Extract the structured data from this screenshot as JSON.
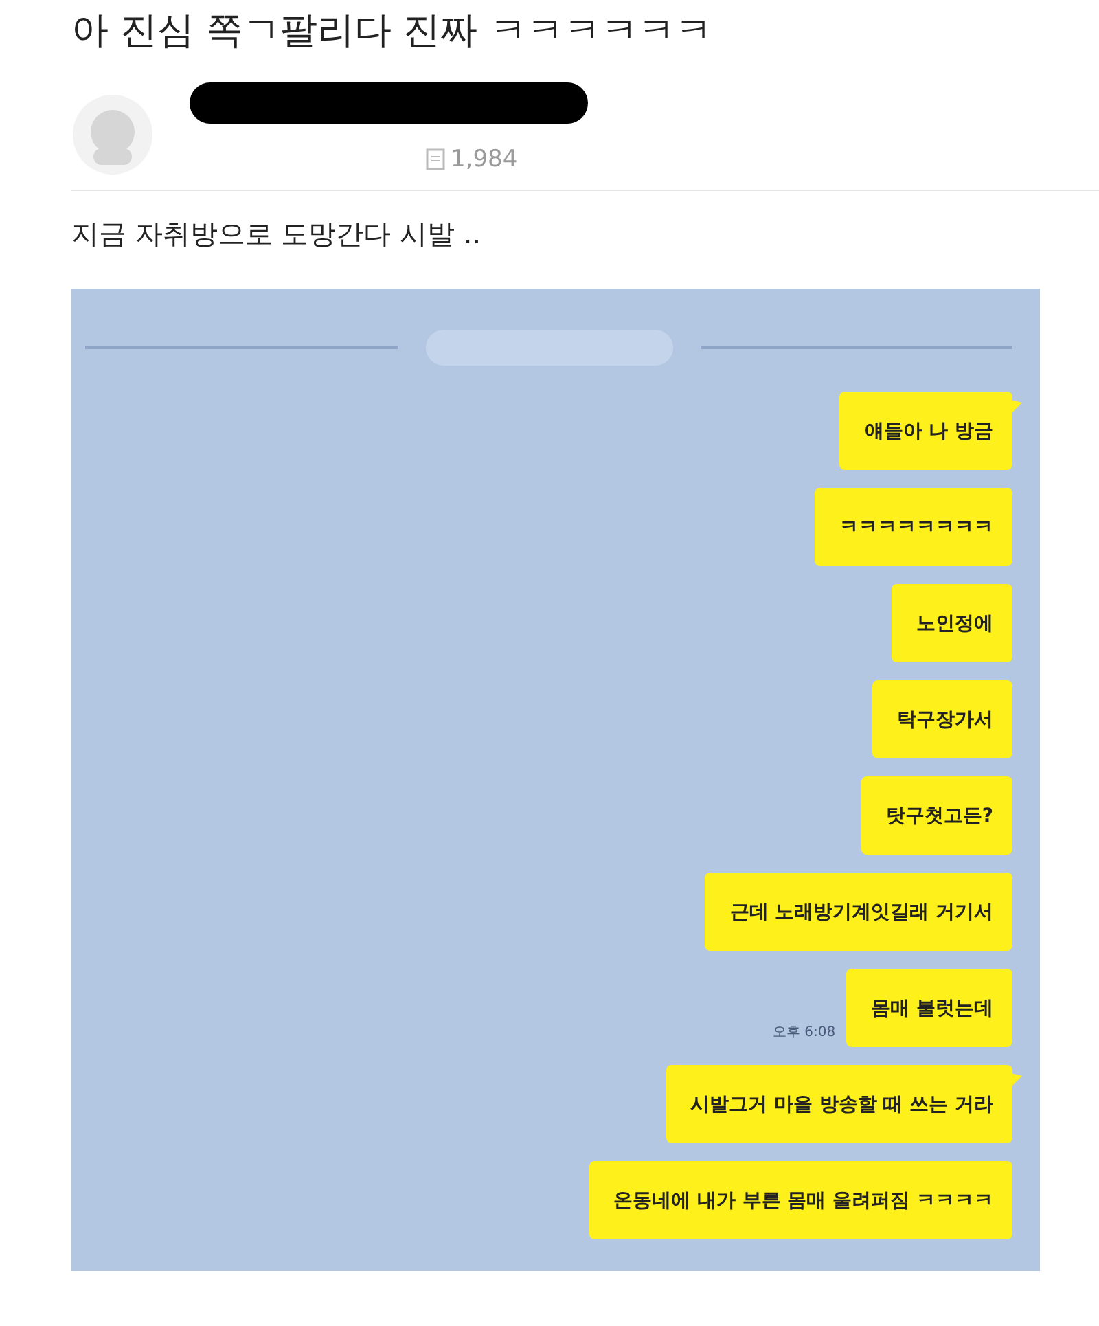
{
  "post": {
    "title": "아 진심 쪽ㄱ팔리다 진짜 ㅋㅋㅋㅋㅋㅋ",
    "author": {
      "redacted": true
    },
    "views": "1,984",
    "body": "지금 자취방으로 도망간다 시발 .."
  },
  "chat": {
    "messages": [
      {
        "text": "얘들아 나 방금",
        "tail": true
      },
      {
        "text": "ㅋㅋㅋㅋㅋㅋㅋㅋ",
        "tail": false
      },
      {
        "text": "노인정에",
        "tail": false
      },
      {
        "text": "탁구장가서",
        "tail": false
      },
      {
        "text": "탓구쳣고든?",
        "tail": false
      },
      {
        "text": "근데 노래방기계잇길래 거기서",
        "tail": false
      },
      {
        "text": "몸매 불럿는데",
        "tail": false,
        "time": "오후 6:08"
      },
      {
        "text": "시발그거 마을 방송할 때 쓰는 거라",
        "tail": true
      },
      {
        "text": "온동네에 내가 부른 몸매 울려퍼짐 ㅋㅋㅋㅋ",
        "tail": false
      }
    ]
  }
}
